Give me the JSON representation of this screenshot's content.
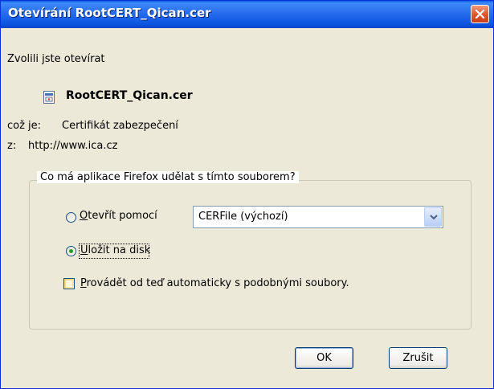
{
  "window": {
    "title": "Otevírání RootCERT_Qican.cer"
  },
  "dialog": {
    "intro": "Zvolili jste otevírat",
    "file_name": "RootCERT_Qican.cer",
    "type_label": "což je:",
    "type_value": "Certifikát zabezpečení",
    "from_label": "z:",
    "from_value": "http://www.ica.cz"
  },
  "action_group": {
    "legend": "Co má aplikace Firefox udělat s tímto souborem?",
    "open_with": {
      "label_prefix": "O",
      "label_rest": "tevřít pomocí",
      "selected": false
    },
    "app_select": {
      "value": "CERFile (výchozí)"
    },
    "save_to_disk": {
      "label_prefix": "U",
      "label_rest": "ložit na disk",
      "selected": true
    },
    "auto_checkbox": {
      "label_prefix": "P",
      "label_rest": "rovádět od teď automaticky s podobnými soubory.",
      "checked": false
    }
  },
  "buttons": {
    "ok": "OK",
    "cancel": "Zrušit"
  },
  "icons": {
    "close": "close-icon",
    "file": "certificate-file-icon",
    "dropdown": "chevron-down-icon"
  },
  "colors": {
    "titlebar": "#0b55e0",
    "close": "#e0532a",
    "radio_dot": "#21a121",
    "checkbox": "#f4d57e"
  }
}
